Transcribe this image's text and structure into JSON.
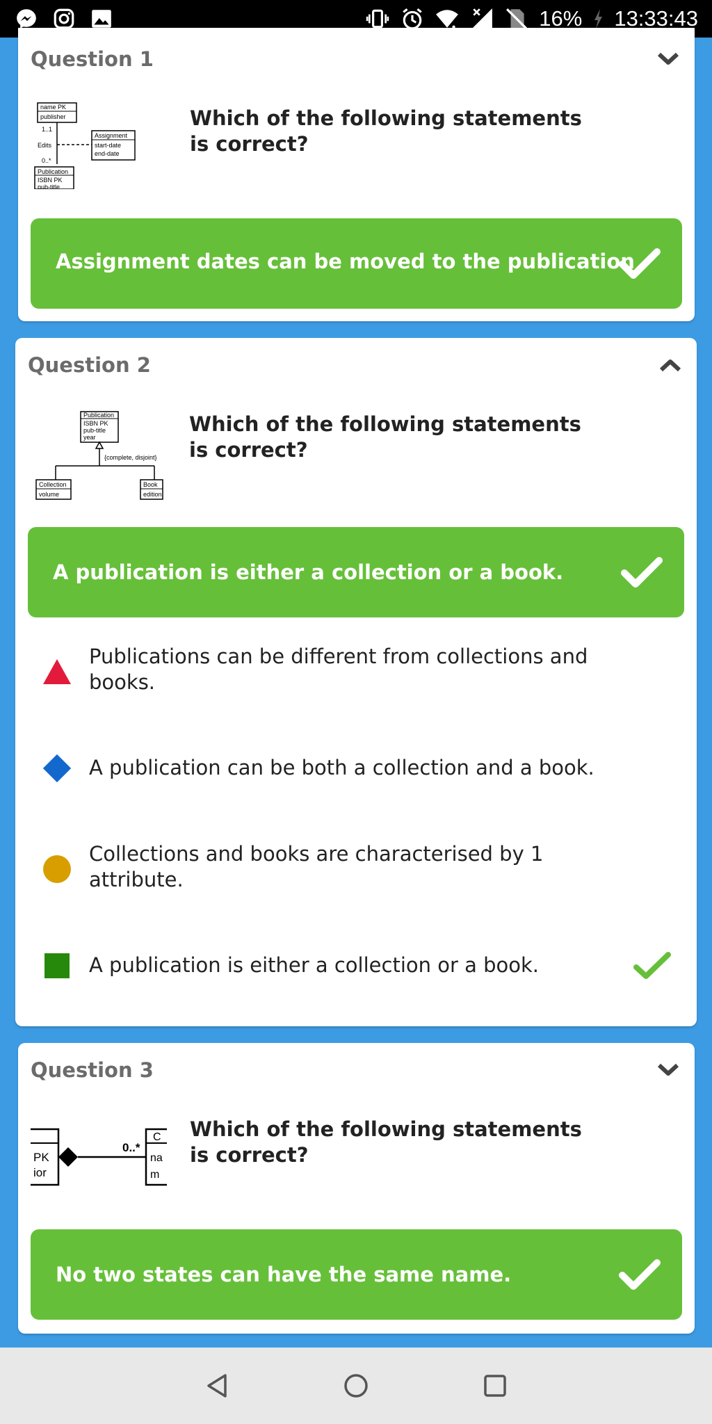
{
  "status_bar": {
    "battery": "16%",
    "time": "13:33:43",
    "icons": [
      "messenger-icon",
      "instagram-icon",
      "gallery-icon",
      "vibrate-icon",
      "alarm-icon",
      "wifi-icon",
      "signal-icon",
      "no-sim-icon",
      "charging-icon"
    ]
  },
  "questions": [
    {
      "title": "Question 1",
      "text": "Which of the following statements is correct?",
      "correct_answer": "Assignment dates can be moved to the publication",
      "expanded": false,
      "diagram": {
        "box1": [
          "name PK",
          "publisher"
        ],
        "mult_top": "1..1",
        "assoc": "Edits",
        "mult_bottom": "0..*",
        "box2": [
          "Assignment",
          "start-date",
          "end-date"
        ],
        "box3": [
          "Publication",
          "ISBN PK",
          "pub-title"
        ]
      }
    },
    {
      "title": "Question 2",
      "text": "Which of the following statements is correct?",
      "correct_answer": "A publication is either a collection or a book.",
      "expanded": true,
      "diagram": {
        "parent": [
          "Publication",
          "ISBN PK",
          "pub-title",
          "year"
        ],
        "constraint": "{complete, disjoint}",
        "child1": [
          "Collection",
          "volume"
        ],
        "child2": [
          "Book",
          "edition"
        ]
      },
      "options": [
        {
          "shape": "triangle",
          "color": "#e21b3c",
          "text": "Publications can be different from collections and books.",
          "correct": false
        },
        {
          "shape": "diamond",
          "color": "#1368ce",
          "text": "A publication can be both a collection and a book.",
          "correct": false
        },
        {
          "shape": "circle",
          "color": "#d89e00",
          "text": "Collections and books are characterised by 1 attribute.",
          "correct": false
        },
        {
          "shape": "square",
          "color": "#26890c",
          "text": "A publication is either a collection or a book.",
          "correct": true
        }
      ]
    },
    {
      "title": "Question 3",
      "text": "Which of the following statements is correct?",
      "correct_answer": "No two states can have the same name.",
      "expanded": false,
      "diagram": {
        "left": [
          "PK",
          "ior"
        ],
        "mult": "0..*",
        "right": [
          "C",
          "na",
          "m"
        ]
      }
    }
  ],
  "colors": {
    "background": "#3d9be4",
    "correct_green": "#66bf39",
    "check_green": "#66bf39",
    "title_gray": "#6b6b6b"
  }
}
